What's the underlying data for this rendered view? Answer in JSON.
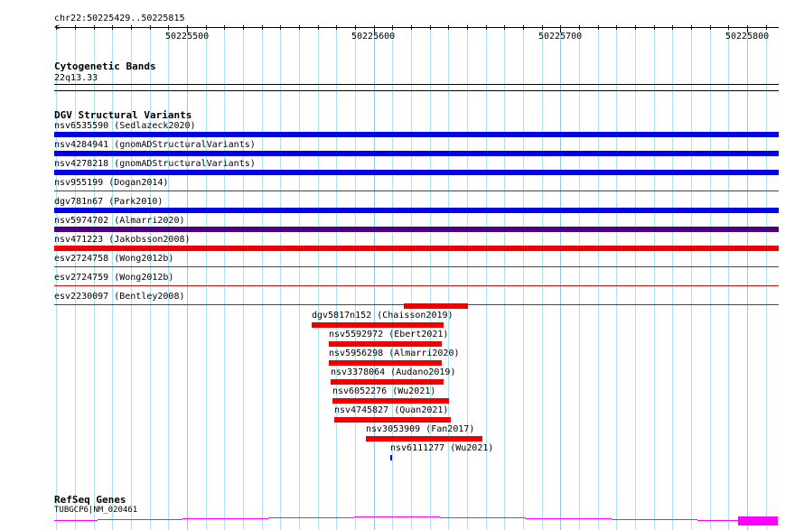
{
  "ruler": {
    "location": "chr22:50225429..50225815",
    "ticks": [
      "50225500",
      "50225600",
      "50225700",
      "50225800"
    ]
  },
  "cytobands": {
    "title": "Cytogenetic Bands",
    "band": "22q13.33"
  },
  "dgv": {
    "title": "DGV Structural Variants",
    "rows": [
      {
        "label": "nsv6535590 (Sedlazeck2020)",
        "color": "#0000ee"
      },
      {
        "label": "nsv4284941 (gnomADStructuralVariants)",
        "color": "#0000ee"
      },
      {
        "label": "nsv4278218 (gnomADStructuralVariants)",
        "color": "#0000ee"
      },
      {
        "label": "nsv955199 (Dogan2014)",
        "color": "#ee0000"
      },
      {
        "label": "dgv781n67 (Park2010)",
        "color": "#0000ee"
      },
      {
        "label": "nsv5974702 (Almarri2020)",
        "color": "#4b0082"
      },
      {
        "label": "nsv471223 (Jakobsson2008)",
        "color": "#ee0000"
      },
      {
        "label": "esv2724758 (Wong2012b)",
        "color": "#ee0000"
      },
      {
        "label": "esv2724759 (Wong2012b)",
        "color": "#ee0000"
      },
      {
        "label": "esv2230097 (Bentley2008)",
        "color": "#ee0000"
      }
    ],
    "features": [
      {
        "label": "dgv5817n152 (Chaisson2019)",
        "color": "#ee0000"
      },
      {
        "label": "nsv5592972 (Ebert2021)",
        "color": "#ee0000"
      },
      {
        "label": "nsv5956298 (Almarri2020)",
        "color": "#ee0000"
      },
      {
        "label": "nsv3378064 (Audano2019)",
        "color": "#ee0000"
      },
      {
        "label": "nsv6052276 (Wu2021)",
        "color": "#ee0000"
      },
      {
        "label": "nsv4745827 (Quan2021)",
        "color": "#ee0000"
      },
      {
        "label": "nsv3053909 (Fan2017)",
        "color": "#ee0000"
      },
      {
        "label": "nsv6111277 (Wu2021)",
        "color": "#0000ee"
      }
    ]
  },
  "refseq": {
    "title": "RefSeq Genes",
    "gene": "TUBGCP6|NM_020461",
    "color": "#ff00ff"
  }
}
